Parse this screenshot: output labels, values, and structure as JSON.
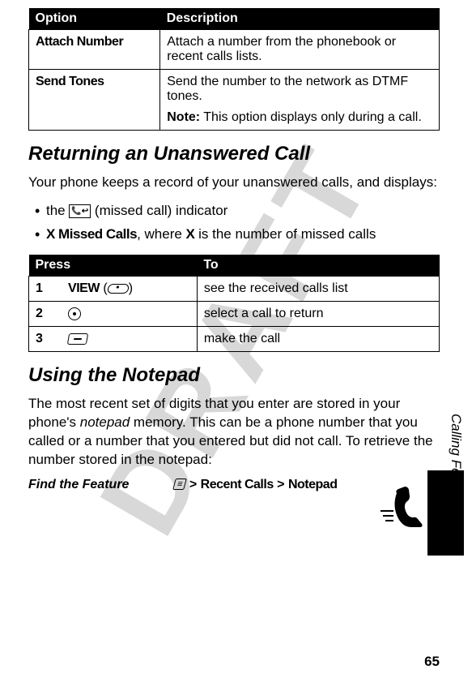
{
  "watermark": "DRAFT",
  "options_table": {
    "headers": [
      "Option",
      "Description"
    ],
    "rows": [
      {
        "option": "Attach Number",
        "description": "Attach a number from the phonebook or recent calls lists."
      },
      {
        "option": "Send Tones",
        "description_line1": "Send the number to the network as DTMF tones.",
        "note_label": "Note:",
        "note_text": " This option displays only during a call."
      }
    ]
  },
  "section1": {
    "heading": "Returning an Unanswered Call",
    "intro": "Your phone keeps a record of your unanswered calls, and displays:",
    "bullets": [
      {
        "prefix": "the ",
        "icon_name": "missed-call-icon",
        "suffix": " (missed call) indicator"
      },
      {
        "bold_text": "X Missed Calls",
        "middle": ", where ",
        "bold_text2": "X",
        "suffix": " is the number of missed calls"
      }
    ]
  },
  "steps_table": {
    "headers": [
      "Press",
      "To"
    ],
    "rows": [
      {
        "num": "1",
        "press": "VIEW",
        "press_suffix": " (",
        "press_suffix2": ")",
        "to": "see the received calls list"
      },
      {
        "num": "2",
        "icon": "nav-circle",
        "to": "select a call to return"
      },
      {
        "num": "3",
        "icon": "call-key",
        "to": "make the call"
      }
    ]
  },
  "section2": {
    "heading": "Using the Notepad",
    "body_part1": "The most recent set of digits that you enter are stored in your phone's ",
    "body_italic": "notepad",
    "body_part2": " memory. This can be a phone number that you called or a number that you entered but did not call. To retrieve the number stored in the notepad:"
  },
  "find_feature": {
    "label": "Find the Feature",
    "path_item1": "Recent Calls",
    "path_item2": "Notepad"
  },
  "side_label": "Calling Features",
  "page_number": "65"
}
